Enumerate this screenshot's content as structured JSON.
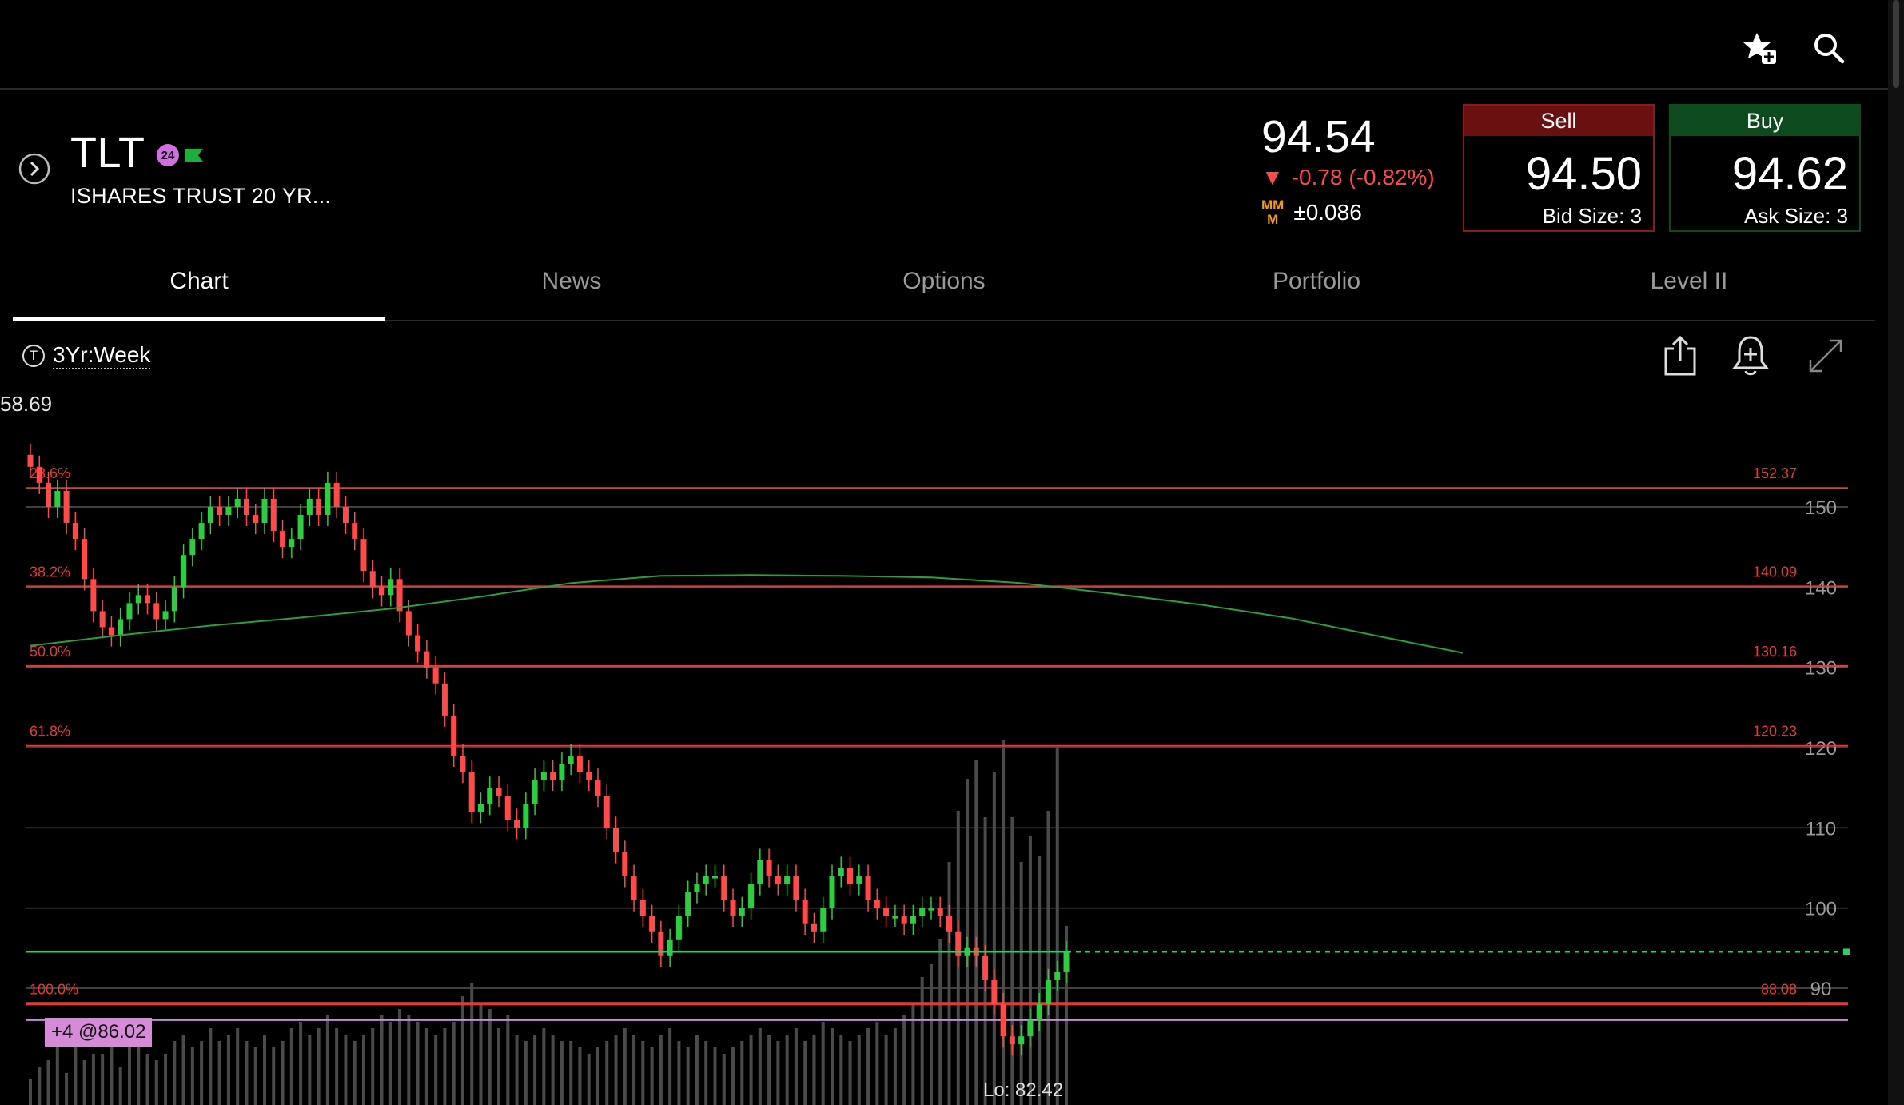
{
  "header": {
    "watchlist_icon": "star-plus-icon",
    "search_icon": "search-icon"
  },
  "quote": {
    "symbol": "TLT",
    "badge_24": "24",
    "company_name": "ISHARES TRUST 20 YR...",
    "last_price": "94.54",
    "change_arrow": "▼",
    "change": "-0.78 (-0.82%)",
    "mm_label_top": "MM",
    "mm_label_bottom": "M",
    "mm_spread": "±0.086",
    "sell": {
      "label": "Sell",
      "price": "94.50",
      "size_label": "Bid Size: 3"
    },
    "buy": {
      "label": "Buy",
      "price": "94.62",
      "size_label": "Ask Size: 3"
    },
    "colors": {
      "down": "#ff4a4a",
      "sell": "#6b1010",
      "buy": "#0d4a1d",
      "up": "#2ecc40"
    }
  },
  "tabs": [
    {
      "label": "Chart",
      "active": true
    },
    {
      "label": "News",
      "active": false
    },
    {
      "label": "Options",
      "active": false
    },
    {
      "label": "Portfolio",
      "active": false
    },
    {
      "label": "Level II",
      "active": false
    }
  ],
  "chart_toolbar": {
    "period_icon": "T",
    "period_label": "3Yr:Week",
    "share_icon": "share-icon",
    "alert_icon": "bell-plus-icon",
    "expand_icon": "expand-icon"
  },
  "chart_data": {
    "type": "candlestick",
    "top_price_label": "58.69",
    "y_ticks": [
      "150",
      "140",
      "130",
      "120",
      "110",
      "100",
      "90"
    ],
    "y_tick_values": [
      150,
      140,
      130,
      120,
      110,
      100,
      90
    ],
    "ylim": [
      80.8,
      158.7
    ],
    "fib_levels": [
      {
        "pct": "23.6%",
        "value": "152.37"
      },
      {
        "pct": "38.2%",
        "value": "140.09"
      },
      {
        "pct": "50.0%",
        "value": "130.16"
      },
      {
        "pct": "61.8%",
        "value": "120.23"
      },
      {
        "pct": "100.0%",
        "value": "88.08"
      }
    ],
    "current_price": 94.54,
    "position_line": 86.02,
    "position_label": "+4 @86.02",
    "low_label": "Lo: 82.42",
    "moving_average": [
      [
        0,
        132.7
      ],
      [
        10,
        134
      ],
      [
        20,
        135.2
      ],
      [
        30,
        136.2
      ],
      [
        40,
        137.3
      ],
      [
        50,
        138.8
      ],
      [
        60,
        140.5
      ],
      [
        70,
        141.4
      ],
      [
        80,
        141.5
      ],
      [
        90,
        141.4
      ],
      [
        100,
        141.2
      ],
      [
        110,
        140.5
      ],
      [
        120,
        139.2
      ],
      [
        130,
        137.8
      ],
      [
        140,
        136.1
      ],
      [
        150,
        133.8
      ],
      [
        159,
        131.8
      ]
    ],
    "weekly_closes": [
      155,
      153,
      150,
      152,
      148,
      146,
      141,
      137,
      135,
      134,
      136,
      138,
      139,
      138,
      136,
      137,
      140,
      144,
      146,
      148,
      150,
      149,
      150,
      151,
      149,
      148,
      151,
      147,
      145,
      146,
      149,
      151,
      149,
      153,
      150,
      148,
      146,
      142,
      140,
      139,
      141,
      137,
      134,
      132,
      130,
      128,
      124,
      119,
      117,
      112,
      113,
      115,
      114,
      111,
      110,
      113,
      116,
      117,
      116,
      118,
      119,
      117,
      116,
      114,
      110,
      107,
      104,
      101,
      99,
      97,
      94,
      96,
      99,
      102,
      103,
      104,
      104,
      101,
      99,
      100,
      103,
      106,
      104,
      103,
      104,
      101,
      98,
      97,
      100,
      104,
      105,
      103,
      104,
      101,
      100,
      99,
      99,
      98,
      99,
      100,
      100,
      99,
      97,
      94,
      95,
      94,
      91,
      88,
      84,
      83,
      84,
      86,
      88,
      91,
      92,
      94.5
    ],
    "volumes": [
      20,
      30,
      35,
      45,
      25,
      50,
      35,
      40,
      40,
      45,
      30,
      50,
      55,
      40,
      35,
      40,
      50,
      55,
      45,
      50,
      60,
      50,
      55,
      60,
      50,
      45,
      55,
      45,
      50,
      60,
      65,
      55,
      60,
      70,
      60,
      55,
      50,
      55,
      60,
      70,
      65,
      75,
      70,
      65,
      60,
      55,
      60,
      65,
      85,
      95,
      80,
      75,
      60,
      70,
      55,
      50,
      55,
      60,
      55,
      50,
      50,
      45,
      40,
      45,
      50,
      55,
      60,
      55,
      50,
      45,
      55,
      60,
      50,
      45,
      55,
      50,
      45,
      40,
      45,
      50,
      55,
      60,
      55,
      50,
      55,
      60,
      50,
      55,
      65,
      60,
      55,
      50,
      55,
      60,
      65,
      55,
      60,
      70,
      80,
      100,
      110,
      130,
      190,
      230,
      255,
      270,
      225,
      260,
      285,
      225,
      190,
      210,
      195,
      230,
      280,
      140
    ]
  }
}
